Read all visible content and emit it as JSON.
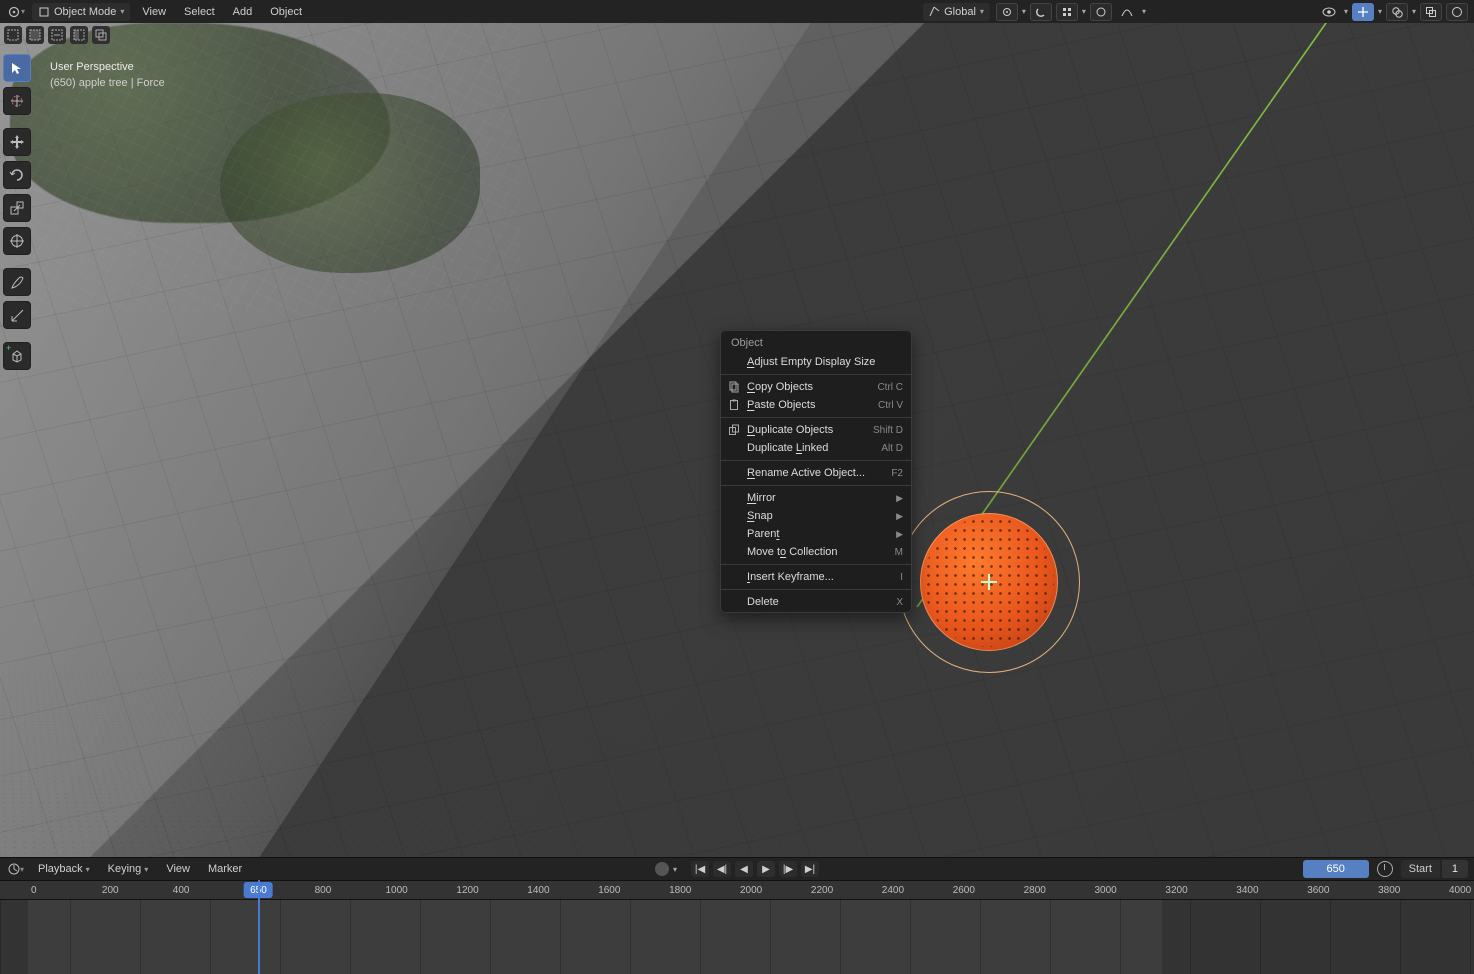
{
  "header": {
    "mode_label": "Object Mode",
    "menus": [
      "View",
      "Select",
      "Add",
      "Object"
    ],
    "orientation": "Global"
  },
  "hud": {
    "line1": "User Perspective",
    "line2": "(650) apple tree | Force"
  },
  "context_menu": {
    "title": "Object",
    "items": [
      {
        "label": "Adjust Empty Display Size",
        "underline": 0,
        "shortcut": "",
        "icon": "",
        "submenu": false
      },
      "sep",
      {
        "label": "Copy Objects",
        "underline": 0,
        "shortcut": "Ctrl C",
        "icon": "copy",
        "submenu": false
      },
      {
        "label": "Paste Objects",
        "underline": 0,
        "shortcut": "Ctrl V",
        "icon": "paste",
        "submenu": false
      },
      "sep",
      {
        "label": "Duplicate Objects",
        "underline": 0,
        "shortcut": "Shift D",
        "icon": "dup",
        "submenu": false
      },
      {
        "label": "Duplicate Linked",
        "underline": 10,
        "shortcut": "Alt D",
        "icon": "",
        "submenu": false
      },
      "sep",
      {
        "label": "Rename Active Object...",
        "underline": 0,
        "shortcut": "F2",
        "icon": "",
        "submenu": false
      },
      "sep",
      {
        "label": "Mirror",
        "underline": 0,
        "shortcut": "",
        "icon": "",
        "submenu": true
      },
      {
        "label": "Snap",
        "underline": 0,
        "shortcut": "",
        "icon": "",
        "submenu": true
      },
      {
        "label": "Parent",
        "underline": 5,
        "shortcut": "",
        "icon": "",
        "submenu": true
      },
      {
        "label": "Move to Collection",
        "underline": 6,
        "shortcut": "M",
        "icon": "",
        "submenu": false
      },
      "sep",
      {
        "label": "Insert Keyframe...",
        "underline": 0,
        "shortcut": "I",
        "icon": "",
        "submenu": false
      },
      "sep",
      {
        "label": "Delete",
        "underline": -1,
        "shortcut": "X",
        "icon": "",
        "submenu": false
      }
    ]
  },
  "timeline": {
    "menus": [
      "Playback",
      "Keying",
      "View",
      "Marker"
    ],
    "current_frame": "650",
    "start_label": "Start",
    "start_value": "1",
    "ruler_start": 0,
    "ruler_end": 4000,
    "ruler_step": 200,
    "viewport_start": 1,
    "viewport_end": 3200
  }
}
